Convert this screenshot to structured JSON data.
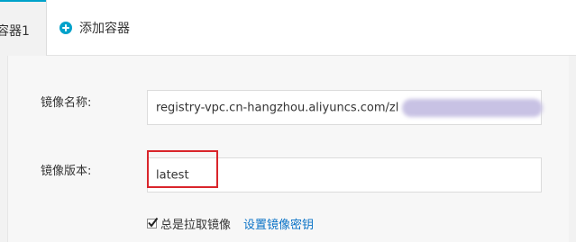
{
  "tabs": {
    "active_label": "容器1",
    "add_label": "添加容器"
  },
  "form": {
    "image_name": {
      "label": "镜像名称:",
      "value": "registry-vpc.cn-hangzhou.aliyuncs.com/zl"
    },
    "image_version": {
      "label": "镜像版本:",
      "value": "latest"
    },
    "always_pull": {
      "label": "总是拉取镜像",
      "checked": true
    },
    "set_secret_link": "设置镜像密钥"
  },
  "colors": {
    "accent": "#00a2ca",
    "link": "#0b73c7",
    "highlight": "#d9252b"
  },
  "icons": {
    "add": "plus-circle-icon",
    "check": "checkmark-icon"
  }
}
